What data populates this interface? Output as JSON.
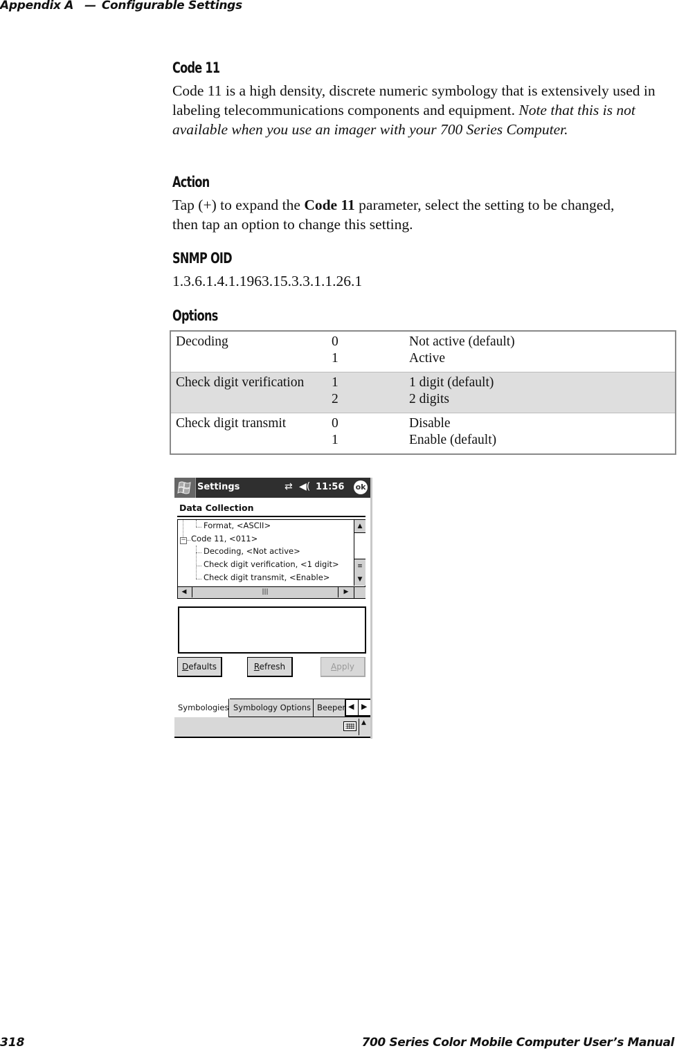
{
  "header": {
    "appendix": "Appendix A",
    "dash": "—",
    "chapter": "Configurable Settings"
  },
  "section": {
    "title": "Code 11",
    "desc_plain": "Code 11 is a high density, discrete numeric symbology that is extensively used in labeling telecommunications components and equipment. ",
    "desc_italic": "Note that this is not available when you use an imager with your 700 Series Computer."
  },
  "action": {
    "title": "Action",
    "text_before": "Tap (+) to expand the ",
    "text_bold": "Code 11",
    "text_after": " parameter, select the setting to be changed, then tap an option to change this setting."
  },
  "snmp": {
    "title": "SNMP OID",
    "value": "1.3.6.1.4.1.1963.15.3.3.1.1.26.1"
  },
  "options": {
    "title": "Options",
    "rows": [
      {
        "name": "Decoding",
        "values": [
          "0",
          "1"
        ],
        "descs": [
          "Not active (default)",
          "Active"
        ]
      },
      {
        "name": "Check digit verification",
        "values": [
          "1",
          "2"
        ],
        "descs": [
          "1 digit (default)",
          "2 digits"
        ]
      },
      {
        "name": "Check digit transmit",
        "values": [
          "0",
          "1"
        ],
        "descs": [
          "Disable",
          "Enable (default)"
        ]
      }
    ]
  },
  "device": {
    "titlebar": {
      "title": "Settings",
      "connectivity_icon": "⇄",
      "volume_icon": "◀(",
      "time": "11:56",
      "ok_label": "ok"
    },
    "page_title": "Data Collection",
    "tree": [
      {
        "label": "Format, <ASCII>"
      },
      {
        "label": "Code 11, <011>",
        "expander": "−"
      },
      {
        "label": "Decoding, <Not active>"
      },
      {
        "label": "Check digit verification, <1 digit>"
      },
      {
        "label": "Check digit transmit, <Enable>"
      }
    ],
    "buttons": {
      "defaults": {
        "accel": "D",
        "rest": "efaults"
      },
      "refresh": {
        "accel": "R",
        "rest": "efresh"
      },
      "apply": {
        "accel": "A",
        "rest": "pply"
      }
    },
    "tabs": [
      "Symbologies",
      "Symbology Options",
      "Beeper"
    ],
    "active_tab": "Symbologies",
    "tab_arrows": {
      "left": "◀",
      "right": "▶"
    }
  },
  "footer": {
    "page_number": "318",
    "manual_title": "700 Series Color Mobile Computer User’s Manual"
  }
}
